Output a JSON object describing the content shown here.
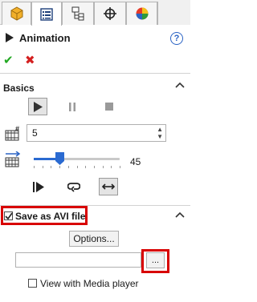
{
  "tabs": [
    {
      "icon": "feature-manager-icon",
      "active": false
    },
    {
      "icon": "property-manager-icon",
      "active": true
    },
    {
      "icon": "configuration-manager-icon",
      "active": false
    },
    {
      "icon": "dimxpert-icon",
      "active": false
    },
    {
      "icon": "display-manager-icon",
      "active": false
    }
  ],
  "header": {
    "title": "Animation",
    "help": "?"
  },
  "actions": {
    "ok": "✔",
    "cancel": "✖"
  },
  "basics": {
    "title": "Basics",
    "frames_value": "5",
    "slider_value": "45",
    "slider_fraction": 0.3
  },
  "save": {
    "title": "Save as AVI file",
    "checked": true,
    "options_label": "Options...",
    "file_path": "",
    "browse_label": "...",
    "media_player_label": "View with Media player",
    "media_player_checked": false
  },
  "colors": {
    "accent": "#2a6ad1",
    "highlight": "#d80000",
    "ok": "#22a822",
    "cancel": "#d42020"
  }
}
